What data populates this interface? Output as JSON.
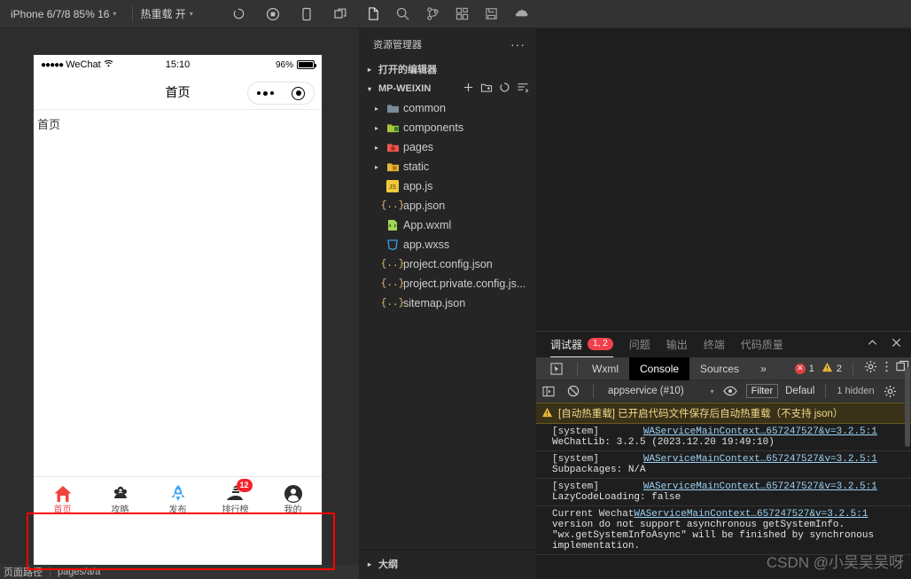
{
  "simulator": {
    "toolbar": {
      "device": "iPhone 6/7/8 85% 16",
      "hotreload": "热重载 开",
      "icons": [
        "refresh-icon",
        "record-icon",
        "device-icon",
        "window-icon"
      ]
    },
    "statusbar": {
      "carrier": "WeChat",
      "time": "15:10",
      "battery": "96%"
    },
    "navbar": {
      "title": "首页"
    },
    "page": {
      "label": "首页"
    },
    "tabbar": [
      {
        "label": "首页",
        "icon": "home-icon",
        "active": true,
        "badge": ""
      },
      {
        "label": "攻略",
        "icon": "flower-icon",
        "active": false,
        "badge": ""
      },
      {
        "label": "发布",
        "icon": "rocket-icon",
        "active": false,
        "badge": ""
      },
      {
        "label": "排行榜",
        "icon": "ranking-icon",
        "active": false,
        "badge": "12"
      },
      {
        "label": "我的",
        "icon": "user-icon",
        "active": false,
        "badge": ""
      }
    ],
    "bottombar": {
      "path_label": "页面路径",
      "path_value": "pages/a/a"
    }
  },
  "explorer": {
    "activity_icons": [
      "files-icon",
      "search-icon",
      "source-control-icon",
      "extensions-icon",
      "save-icon",
      "cloud-icon"
    ],
    "title": "资源管理器",
    "more": "···",
    "open_editors": "打开的编辑器",
    "project": "MP-WEIXIN",
    "root_actions": [
      "new-file-icon",
      "new-folder-icon",
      "refresh-icon",
      "collapse-icon"
    ],
    "tree": [
      {
        "name": "common",
        "type": "folder",
        "icon_color": "#7a8a99"
      },
      {
        "name": "components",
        "type": "folder",
        "icon_color": "#a4c639"
      },
      {
        "name": "pages",
        "type": "folder",
        "icon_color": "#e8564f"
      },
      {
        "name": "static",
        "type": "folder",
        "icon_color": "#e8b339"
      },
      {
        "name": "app.js",
        "type": "js"
      },
      {
        "name": "app.json",
        "type": "json"
      },
      {
        "name": "App.wxml",
        "type": "wxml"
      },
      {
        "name": "app.wxss",
        "type": "wxss"
      },
      {
        "name": "project.config.json",
        "type": "json"
      },
      {
        "name": "project.private.config.js...",
        "type": "json"
      },
      {
        "name": "sitemap.json",
        "type": "json"
      }
    ],
    "outline": "大纲"
  },
  "devtools": {
    "tabs": [
      {
        "label": "调试器",
        "badge": "1, 2",
        "active": true
      },
      {
        "label": "问题",
        "badge": "",
        "active": false
      },
      {
        "label": "输出",
        "badge": "",
        "active": false
      },
      {
        "label": "终端",
        "badge": "",
        "active": false
      },
      {
        "label": "代码质量",
        "badge": "",
        "active": false
      }
    ],
    "panel_actions": [
      "chevron-up-icon",
      "close-icon"
    ],
    "subtabs": [
      {
        "label": "Wxml",
        "active": false
      },
      {
        "label": "Console",
        "active": true
      },
      {
        "label": "Sources",
        "active": false
      },
      {
        "label": "»",
        "active": false
      }
    ],
    "counters": {
      "errors": "1",
      "warnings": "2"
    },
    "subtab_actions": [
      "settings-icon",
      "more-icon",
      "dock-icon"
    ],
    "filterbar": {
      "context": "appservice (#10)",
      "filter_placeholder": "Filter",
      "level": "Defaul",
      "hidden": "1 hidden"
    },
    "warning": "[自动热重载] 已开启代码文件保存后自动热重载（不支持 json）",
    "messages": [
      {
        "tag": "[system]",
        "source": "WAServiceMainContext…657247527&v=3.2.5:1",
        "body": "WeChatLib: 3.2.5 (2023.12.20 19:49:10)"
      },
      {
        "tag": "[system]",
        "source": "WAServiceMainContext…657247527&v=3.2.5:1",
        "body": "Subpackages: N/A"
      },
      {
        "tag": "[system]",
        "source": "WAServiceMainContext…657247527&v=3.2.5:1",
        "body": "LazyCodeLoading: false"
      }
    ],
    "last_message": {
      "prefix": "Current Wechat ",
      "source": "WAServiceMainContext…657247527&v=3.2.5:1",
      "body": "version do not support asynchronous getSystemInfo.\n\"wx.getSystemInfoAsync\" will be finished by synchronous\nimplementation."
    },
    "watermark": "CSDN @小吴吴吴呀"
  },
  "colors": {
    "accent_red": "#e94b4b",
    "badge_red": "#f5222d",
    "link_blue": "#9cd2f5"
  }
}
